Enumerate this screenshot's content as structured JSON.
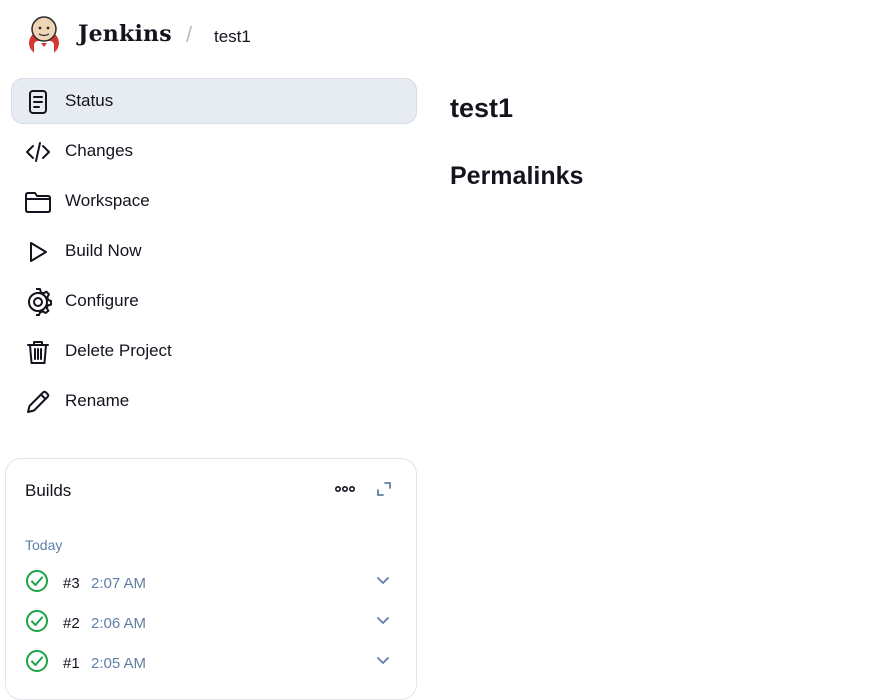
{
  "header": {
    "brand": "Jenkins",
    "separator": "/",
    "breadcrumb": "test1"
  },
  "sidebar": {
    "items": [
      {
        "label": "Status",
        "icon": "document-icon",
        "active": true
      },
      {
        "label": "Changes",
        "icon": "code-icon"
      },
      {
        "label": "Workspace",
        "icon": "folder-icon"
      },
      {
        "label": "Build Now",
        "icon": "play-icon"
      },
      {
        "label": "Configure",
        "icon": "gear-icon"
      },
      {
        "label": "Delete Project",
        "icon": "trash-icon"
      },
      {
        "label": "Rename",
        "icon": "pencil-icon"
      }
    ]
  },
  "builds": {
    "title": "Builds",
    "group": "Today",
    "rows": [
      {
        "number": "#3",
        "time": "2:07 AM",
        "status": "success"
      },
      {
        "number": "#2",
        "time": "2:06 AM",
        "status": "success"
      },
      {
        "number": "#1",
        "time": "2:05 AM",
        "status": "success"
      }
    ]
  },
  "main": {
    "title": "test1",
    "permalinks_heading": "Permalinks"
  },
  "colors": {
    "active_bg": "#e7ebf2",
    "success": "#1ea446",
    "muted": "#5f7fa6"
  }
}
